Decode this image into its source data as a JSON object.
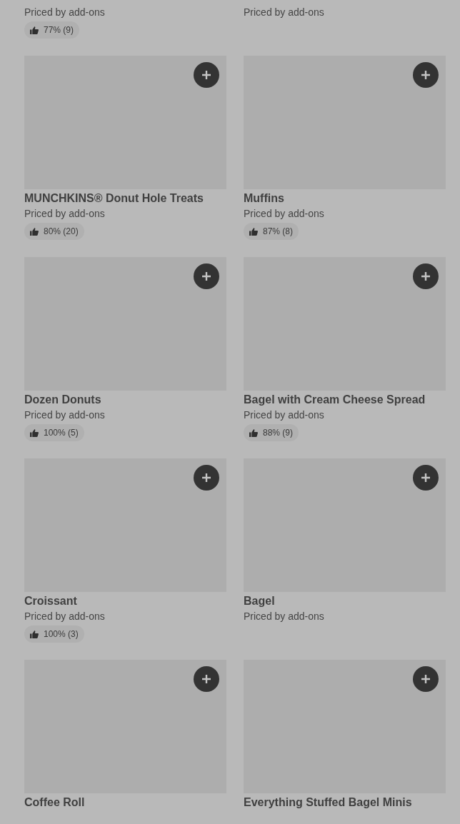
{
  "items": [
    {
      "price": "Priced by add-ons",
      "rating": "77% (9)"
    },
    {
      "price": "Priced by add-ons"
    },
    {
      "name": "MUNCHKINS® Donut Hole Treats",
      "price": "Priced by add-ons",
      "rating": "80% (20)"
    },
    {
      "name": "Muffins",
      "price": "Priced by add-ons",
      "rating": "87% (8)"
    },
    {
      "name": "Dozen Donuts",
      "price": "Priced by add-ons",
      "rating": "100% (5)"
    },
    {
      "name": "Bagel with Cream Cheese Spread",
      "price": "Priced by add-ons",
      "rating": "88% (9)"
    },
    {
      "name": "Croissant",
      "price": "Priced by add-ons",
      "rating": "100% (3)"
    },
    {
      "name": "Bagel",
      "price": "Priced by add-ons"
    },
    {
      "name": "Coffee Roll"
    },
    {
      "name": "Everything Stuffed Bagel Minis"
    }
  ]
}
